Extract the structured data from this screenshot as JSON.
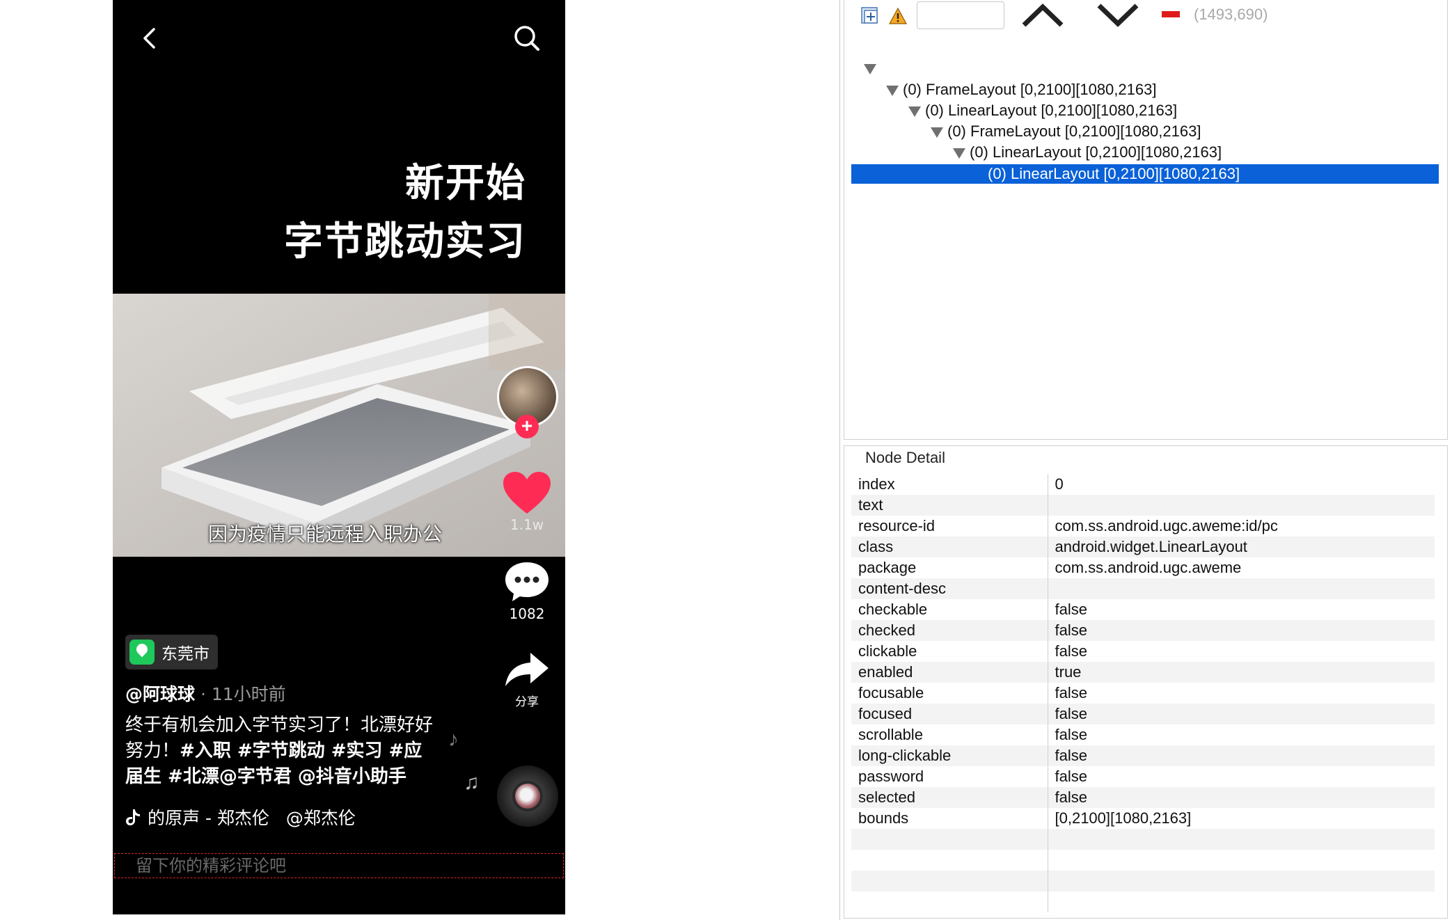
{
  "phone": {
    "headline_line1": "新开始",
    "headline_line2": "字节跳动实习",
    "video_subtitle": "因为疫情只能远程入职办公",
    "like_count": "1.1w",
    "comment_count": "1082",
    "share_label": "分享",
    "location": "东莞市",
    "author": "@阿球球",
    "time_ago": " · 11小时前",
    "caption_plain": "终于有机会加入字节实习了！北漂好好努力！",
    "caption_tags": "#入职 #字节跳动 #实习 #应届生 #北漂@字节君 @抖音小助手",
    "music_title": "的原声 - 郑杰伦",
    "music_author": "@郑杰伦",
    "comment_placeholder": "留下你的精彩评论吧"
  },
  "toolbar": {
    "coordinates": "(1493,690)"
  },
  "tree": [
    "(0) FrameLayout [0,2100][1080,2163]",
    "(0) LinearLayout [0,2100][1080,2163]",
    "(0) FrameLayout [0,2100][1080,2163]",
    "(0) LinearLayout [0,2100][1080,2163]",
    "(0) LinearLayout [0,2100][1080,2163]"
  ],
  "node_detail": {
    "title": "Node Detail",
    "rows": [
      {
        "k": "index",
        "v": "0"
      },
      {
        "k": "text",
        "v": ""
      },
      {
        "k": "resource-id",
        "v": "com.ss.android.ugc.aweme:id/pc"
      },
      {
        "k": "class",
        "v": "android.widget.LinearLayout"
      },
      {
        "k": "package",
        "v": "com.ss.android.ugc.aweme"
      },
      {
        "k": "content-desc",
        "v": ""
      },
      {
        "k": "checkable",
        "v": "false"
      },
      {
        "k": "checked",
        "v": "false"
      },
      {
        "k": "clickable",
        "v": "false"
      },
      {
        "k": "enabled",
        "v": "true"
      },
      {
        "k": "focusable",
        "v": "false"
      },
      {
        "k": "focused",
        "v": "false"
      },
      {
        "k": "scrollable",
        "v": "false"
      },
      {
        "k": "long-clickable",
        "v": "false"
      },
      {
        "k": "password",
        "v": "false"
      },
      {
        "k": "selected",
        "v": "false"
      },
      {
        "k": "bounds",
        "v": "[0,2100][1080,2163]"
      },
      {
        "k": "",
        "v": ""
      },
      {
        "k": "",
        "v": ""
      },
      {
        "k": "",
        "v": ""
      },
      {
        "k": "",
        "v": ""
      }
    ]
  },
  "colors": {
    "selection": "#0a61d8",
    "like": "#fe2c55",
    "location_pin": "#1ec85b"
  }
}
